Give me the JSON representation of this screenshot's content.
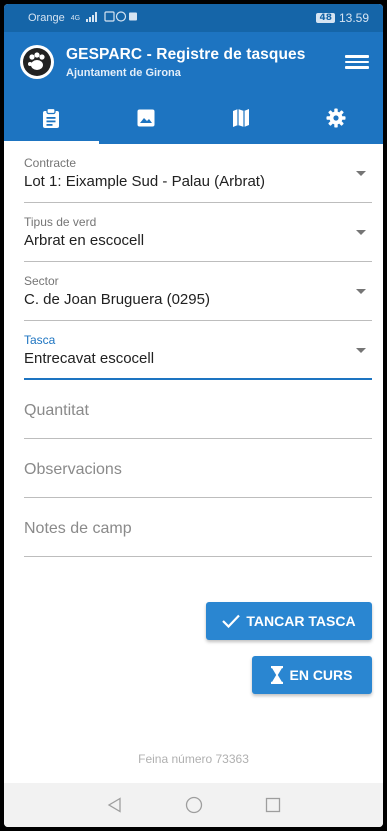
{
  "statusbar": {
    "carrier": "Orange",
    "network": "4G",
    "battery": "48",
    "time": "13.59"
  },
  "appbar": {
    "title": "GESPARC - Registre de tasques",
    "subtitle": "Ajuntament de Girona",
    "logo_icon": "paw-logo-icon",
    "menu_icon": "hamburger-icon"
  },
  "tabs": [
    {
      "icon": "clipboard-icon",
      "active": true
    },
    {
      "icon": "image-icon",
      "active": false
    },
    {
      "icon": "map-icon",
      "active": false
    },
    {
      "icon": "gear-icon",
      "active": false
    }
  ],
  "form": {
    "contracte": {
      "label": "Contracte",
      "value": "Lot 1: Eixample Sud - Palau (Arbrat)"
    },
    "tipus": {
      "label": "Tipus de verd",
      "value": "Arbrat en escocell"
    },
    "sector": {
      "label": "Sector",
      "value": "C. de Joan Bruguera (0295)"
    },
    "tasca": {
      "label": "Tasca",
      "value": "Entrecavat escocell"
    },
    "quantitat": {
      "placeholder": "Quantitat"
    },
    "observacions": {
      "placeholder": "Observacions"
    },
    "notes": {
      "placeholder": "Notes de camp"
    }
  },
  "actions": {
    "close_task": "TANCAR TASCA",
    "in_progress": "EN CURS"
  },
  "footer": {
    "job_number_text": "Feina número 73363"
  },
  "colors": {
    "primary": "#1d74c1",
    "statusbar": "#1565a8",
    "button": "#2a86d1"
  }
}
